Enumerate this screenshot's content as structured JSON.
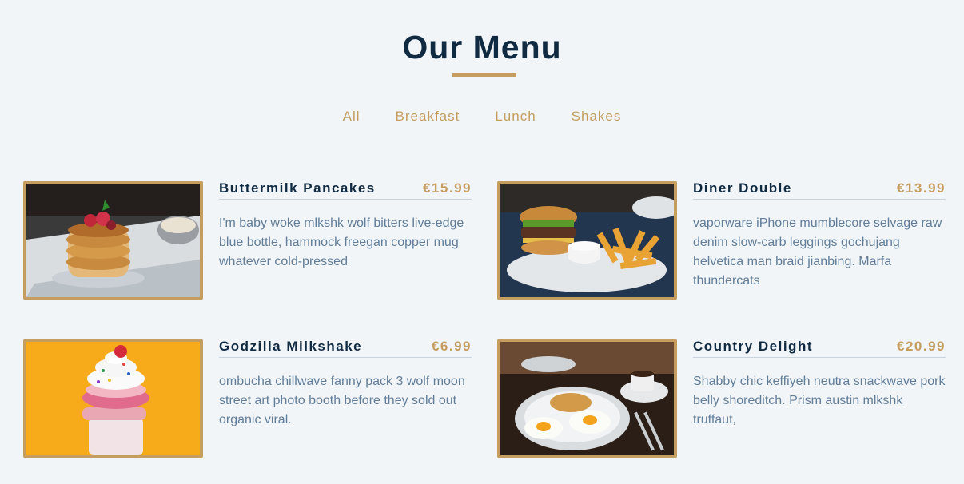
{
  "page": {
    "title": "Our Menu"
  },
  "filters": [
    "All",
    "Breakfast",
    "Lunch",
    "Shakes"
  ],
  "menu": [
    {
      "name": "Buttermilk Pancakes",
      "price": "€15.99",
      "desc": "I'm baby woke mlkshk wolf bitters live-edge blue bottle, hammock freegan copper mug whatever cold-pressed",
      "image_icon": "pancakes-photo"
    },
    {
      "name": "Diner Double",
      "price": "€13.99",
      "desc": "vaporware iPhone mumblecore selvage raw denim slow-carb leggings gochujang helvetica man braid jianbing. Marfa thundercats",
      "image_icon": "burger-photo"
    },
    {
      "name": "Godzilla Milkshake",
      "price": "€6.99",
      "desc": "ombucha chillwave fanny pack 3 wolf moon street art photo booth before they sold out organic viral.",
      "image_icon": "milkshake-photo"
    },
    {
      "name": "Country Delight",
      "price": "€20.99",
      "desc": "Shabby chic keffiyeh neutra snackwave pork belly shoreditch. Prism austin mlkshk truffaut,",
      "image_icon": "eggs-breakfast-photo"
    }
  ],
  "colors": {
    "accent": "#c59d5f",
    "background": "#f1f5f8",
    "heading": "#102a42",
    "text": "#617d98"
  }
}
